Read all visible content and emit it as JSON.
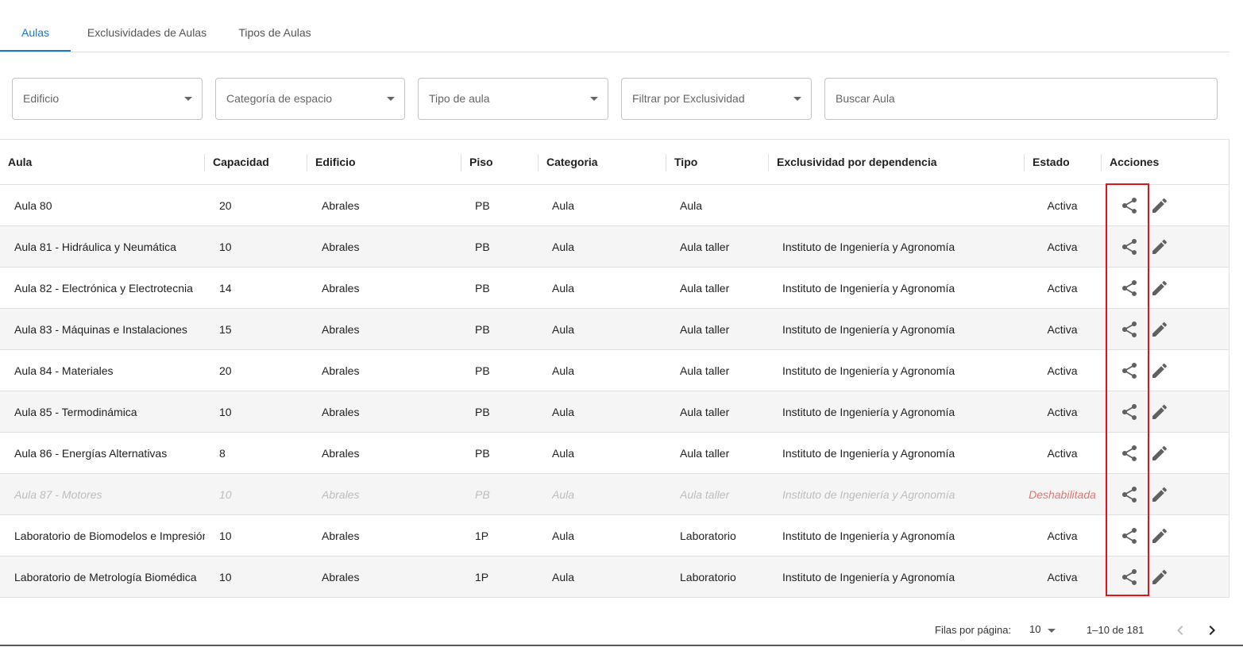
{
  "tabs": [
    {
      "label": "Aulas",
      "active": true
    },
    {
      "label": "Exclusividades de Aulas",
      "active": false
    },
    {
      "label": "Tipos de Aulas",
      "active": false
    }
  ],
  "filters": {
    "edificio": "Edificio",
    "categoria": "Categoría de espacio",
    "tipo": "Tipo de aula",
    "exclusividad": "Filtrar por Exclusividad",
    "buscar": "Buscar Aula"
  },
  "columns": [
    "Aula",
    "Capacidad",
    "Edificio",
    "Piso",
    "Categoria",
    "Tipo",
    "Exclusividad por dependencia",
    "Estado",
    "Acciones"
  ],
  "rows": [
    {
      "aula": "Aula 80",
      "capacidad": "20",
      "edificio": "Abrales",
      "piso": "PB",
      "categoria": "Aula",
      "tipo": "Aula",
      "exclusividad": "",
      "estado": "Activa",
      "disabled": false
    },
    {
      "aula": "Aula 81 - Hidráulica y Neumática",
      "capacidad": "10",
      "edificio": "Abrales",
      "piso": "PB",
      "categoria": "Aula",
      "tipo": "Aula taller",
      "exclusividad": "Instituto de Ingeniería y Agronomía",
      "estado": "Activa",
      "disabled": false
    },
    {
      "aula": "Aula 82 - Electrónica y Electrotecnia",
      "capacidad": "14",
      "edificio": "Abrales",
      "piso": "PB",
      "categoria": "Aula",
      "tipo": "Aula taller",
      "exclusividad": "Instituto de Ingeniería y Agronomía",
      "estado": "Activa",
      "disabled": false
    },
    {
      "aula": "Aula 83 - Máquinas e Instalaciones",
      "capacidad": "15",
      "edificio": "Abrales",
      "piso": "PB",
      "categoria": "Aula",
      "tipo": "Aula taller",
      "exclusividad": "Instituto de Ingeniería y Agronomía",
      "estado": "Activa",
      "disabled": false
    },
    {
      "aula": "Aula 84 - Materiales",
      "capacidad": "20",
      "edificio": "Abrales",
      "piso": "PB",
      "categoria": "Aula",
      "tipo": "Aula taller",
      "exclusividad": "Instituto de Ingeniería y Agronomía",
      "estado": "Activa",
      "disabled": false
    },
    {
      "aula": "Aula 85 - Termodinámica",
      "capacidad": "10",
      "edificio": "Abrales",
      "piso": "PB",
      "categoria": "Aula",
      "tipo": "Aula taller",
      "exclusividad": "Instituto de Ingeniería y Agronomía",
      "estado": "Activa",
      "disabled": false
    },
    {
      "aula": "Aula 86 - Energías Alternativas",
      "capacidad": "8",
      "edificio": "Abrales",
      "piso": "PB",
      "categoria": "Aula",
      "tipo": "Aula taller",
      "exclusividad": "Instituto de Ingeniería y Agronomía",
      "estado": "Activa",
      "disabled": false
    },
    {
      "aula": "Aula 87 - Motores",
      "capacidad": "10",
      "edificio": "Abrales",
      "piso": "PB",
      "categoria": "Aula",
      "tipo": "Aula taller",
      "exclusividad": "Instituto de Ingeniería y Agronomía",
      "estado": "Deshabilitada",
      "disabled": true
    },
    {
      "aula": "Laboratorio de Biomodelos e Impresión",
      "capacidad": "10",
      "edificio": "Abrales",
      "piso": "1P",
      "categoria": "Aula",
      "tipo": "Laboratorio",
      "exclusividad": "Instituto de Ingeniería y Agronomía",
      "estado": "Activa",
      "disabled": false
    },
    {
      "aula": "Laboratorio de Metrología Biomédica",
      "capacidad": "10",
      "edificio": "Abrales",
      "piso": "1P",
      "categoria": "Aula",
      "tipo": "Laboratorio",
      "exclusividad": "Instituto de Ingeniería y Agronomía",
      "estado": "Activa",
      "disabled": false
    }
  ],
  "icons": {
    "share": "share-icon",
    "edit": "pencil-icon",
    "prev": "chevron-left-icon",
    "next": "chevron-right-icon"
  },
  "pagination": {
    "rows_label": "Filas por página:",
    "rows_per_page": "10",
    "range": "1–10 de 181"
  },
  "colors": {
    "accent": "#1976d2",
    "disabled_status": "#e57373",
    "highlight": "#e0131a"
  }
}
